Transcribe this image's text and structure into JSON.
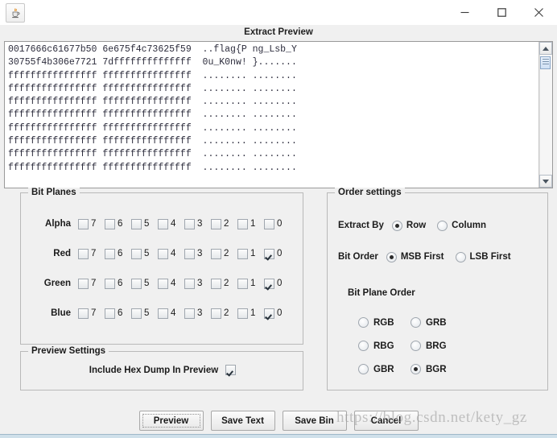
{
  "window": {
    "app_icon": "java-coffee-cup-icon",
    "minimize_label": "Minimize",
    "maximize_label": "Maximize",
    "close_label": "Close"
  },
  "preview": {
    "header_title": "Extract Preview",
    "hex_dump": "0017666c61677b50 6e675f4c73625f59  ..flag{P ng_Lsb_Y\n30755f4b306e7721 7dffffffffffffff  0u_K0nw! }.......\nffffffffffffffff ffffffffffffffff  ........ ........\nffffffffffffffff ffffffffffffffff  ........ ........\nffffffffffffffff ffffffffffffffff  ........ ........\nffffffffffffffff ffffffffffffffff  ........ ........\nffffffffffffffff ffffffffffffffff  ........ ........\nffffffffffffffff ffffffffffffffff  ........ ........\nffffffffffffffff ffffffffffffffff  ........ ........\nffffffffffffffff ffffffffffffffff  ........ ........",
    "scroll_up_icon": "scroll-up-arrow-icon",
    "scroll_down_icon": "scroll-down-arrow-icon"
  },
  "bit_planes": {
    "legend": "Bit Planes",
    "bit_labels": [
      "7",
      "6",
      "5",
      "4",
      "3",
      "2",
      "1",
      "0"
    ],
    "rows": [
      {
        "channel": "Alpha",
        "checked": [
          false,
          false,
          false,
          false,
          false,
          false,
          false,
          false
        ]
      },
      {
        "channel": "Red",
        "checked": [
          false,
          false,
          false,
          false,
          false,
          false,
          false,
          true
        ]
      },
      {
        "channel": "Green",
        "checked": [
          false,
          false,
          false,
          false,
          false,
          false,
          false,
          true
        ]
      },
      {
        "channel": "Blue",
        "checked": [
          false,
          false,
          false,
          false,
          false,
          false,
          false,
          true
        ]
      }
    ]
  },
  "order_settings": {
    "legend": "Order settings",
    "extract_by": {
      "label": "Extract By",
      "options": [
        "Row",
        "Column"
      ],
      "selected": "Row"
    },
    "bit_order": {
      "label": "Bit Order",
      "options": [
        "MSB First",
        "LSB First"
      ],
      "selected": "MSB First"
    },
    "bit_plane_order": {
      "label": "Bit Plane Order",
      "options": [
        "RGB",
        "GRB",
        "RBG",
        "BRG",
        "GBR",
        "BGR"
      ],
      "selected": "BGR"
    }
  },
  "preview_settings": {
    "legend": "Preview Settings",
    "include_hex_dump": {
      "label": "Include Hex Dump In Preview",
      "checked": true
    }
  },
  "buttons": [
    {
      "label": "Preview",
      "focused": true
    },
    {
      "label": "Save Text",
      "focused": false
    },
    {
      "label": "Save Bin",
      "focused": false
    },
    {
      "label": "Cancel",
      "focused": false
    }
  ],
  "watermark": {
    "text": "https://blog.csdn.net/kety_gz"
  },
  "colors": {
    "background": "#f0f0f0",
    "titlebar": "#ffffff",
    "text_area": "#ffffff",
    "hex_text": "#2c2c3c",
    "border": "#b9b9b9",
    "accent_strip": "#cfe0ea"
  }
}
